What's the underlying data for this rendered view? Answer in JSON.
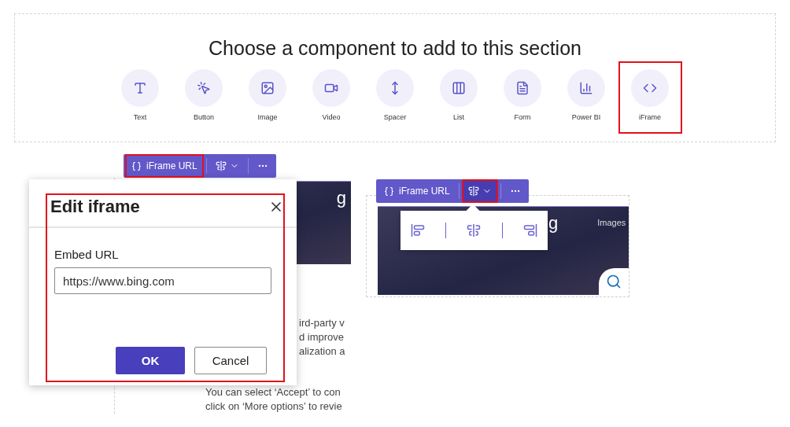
{
  "section": {
    "title": "Choose a component to add to this section",
    "components": [
      {
        "kind": "text",
        "label": "Text",
        "selected": false
      },
      {
        "kind": "button",
        "label": "Button",
        "selected": false
      },
      {
        "kind": "image",
        "label": "Image",
        "selected": false
      },
      {
        "kind": "video",
        "label": "Video",
        "selected": false
      },
      {
        "kind": "spacer",
        "label": "Spacer",
        "selected": false
      },
      {
        "kind": "list",
        "label": "List",
        "selected": false
      },
      {
        "kind": "form",
        "label": "Form",
        "selected": false
      },
      {
        "kind": "chart",
        "label": "Power BI",
        "selected": false
      },
      {
        "kind": "code",
        "label": "iFrame",
        "selected": true
      }
    ]
  },
  "left_example": {
    "toolbar": {
      "url_button": "iFrame URL",
      "url_highlighted": true,
      "align_expanded": false,
      "align_highlighted": false
    },
    "preview": {
      "logo_fragment": "g",
      "text_lines": [
        "ird-party v",
        "d improve",
        "alization a"
      ],
      "notice_lines": [
        "You can select ‘Accept’ to con",
        "click on ‘More options’ to revie"
      ]
    },
    "dialog": {
      "title": "Edit iframe",
      "field_label": "Embed URL",
      "value": "https://www.bing.com",
      "ok": "OK",
      "cancel": "Cancel",
      "highlighted": true
    }
  },
  "right_example": {
    "toolbar": {
      "url_button": "iFrame URL",
      "url_highlighted": false,
      "align_expanded": true,
      "align_highlighted": true
    },
    "preview": {
      "logo_fragment": "g",
      "link": "Images"
    },
    "align_menu": {
      "options": [
        {
          "kind": "left"
        },
        {
          "kind": "center"
        },
        {
          "kind": "right"
        }
      ]
    }
  }
}
